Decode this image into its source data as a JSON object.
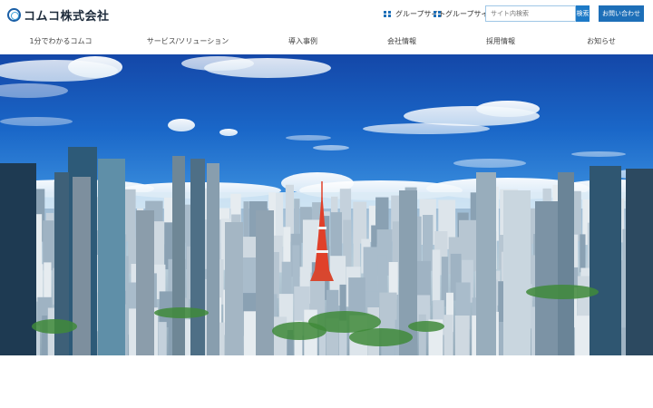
{
  "header": {
    "logo_text": "コムコ株式会社",
    "links": [
      {
        "label": "グループサイト",
        "icon": "grid-icon"
      },
      {
        "label": "グループサイト",
        "icon": "grid-icon"
      }
    ],
    "search": {
      "placeholder": "サイト内検索",
      "button_label": "検索"
    },
    "contact_label": "お問い合わせ"
  },
  "nav": {
    "items": [
      {
        "label": "1分でわかるコムコ"
      },
      {
        "label": "サービス/ソリューション"
      },
      {
        "label": "導入事例"
      },
      {
        "label": "会社情報"
      },
      {
        "label": "採用情報"
      },
      {
        "label": "お知らせ"
      }
    ]
  },
  "hero": {
    "image": "tokyo-skyline-with-tokyo-tower",
    "colors": {
      "sky_top": "#1447a8",
      "tower": "#e0402a"
    }
  },
  "colors": {
    "accent": "#1d6fb8"
  }
}
